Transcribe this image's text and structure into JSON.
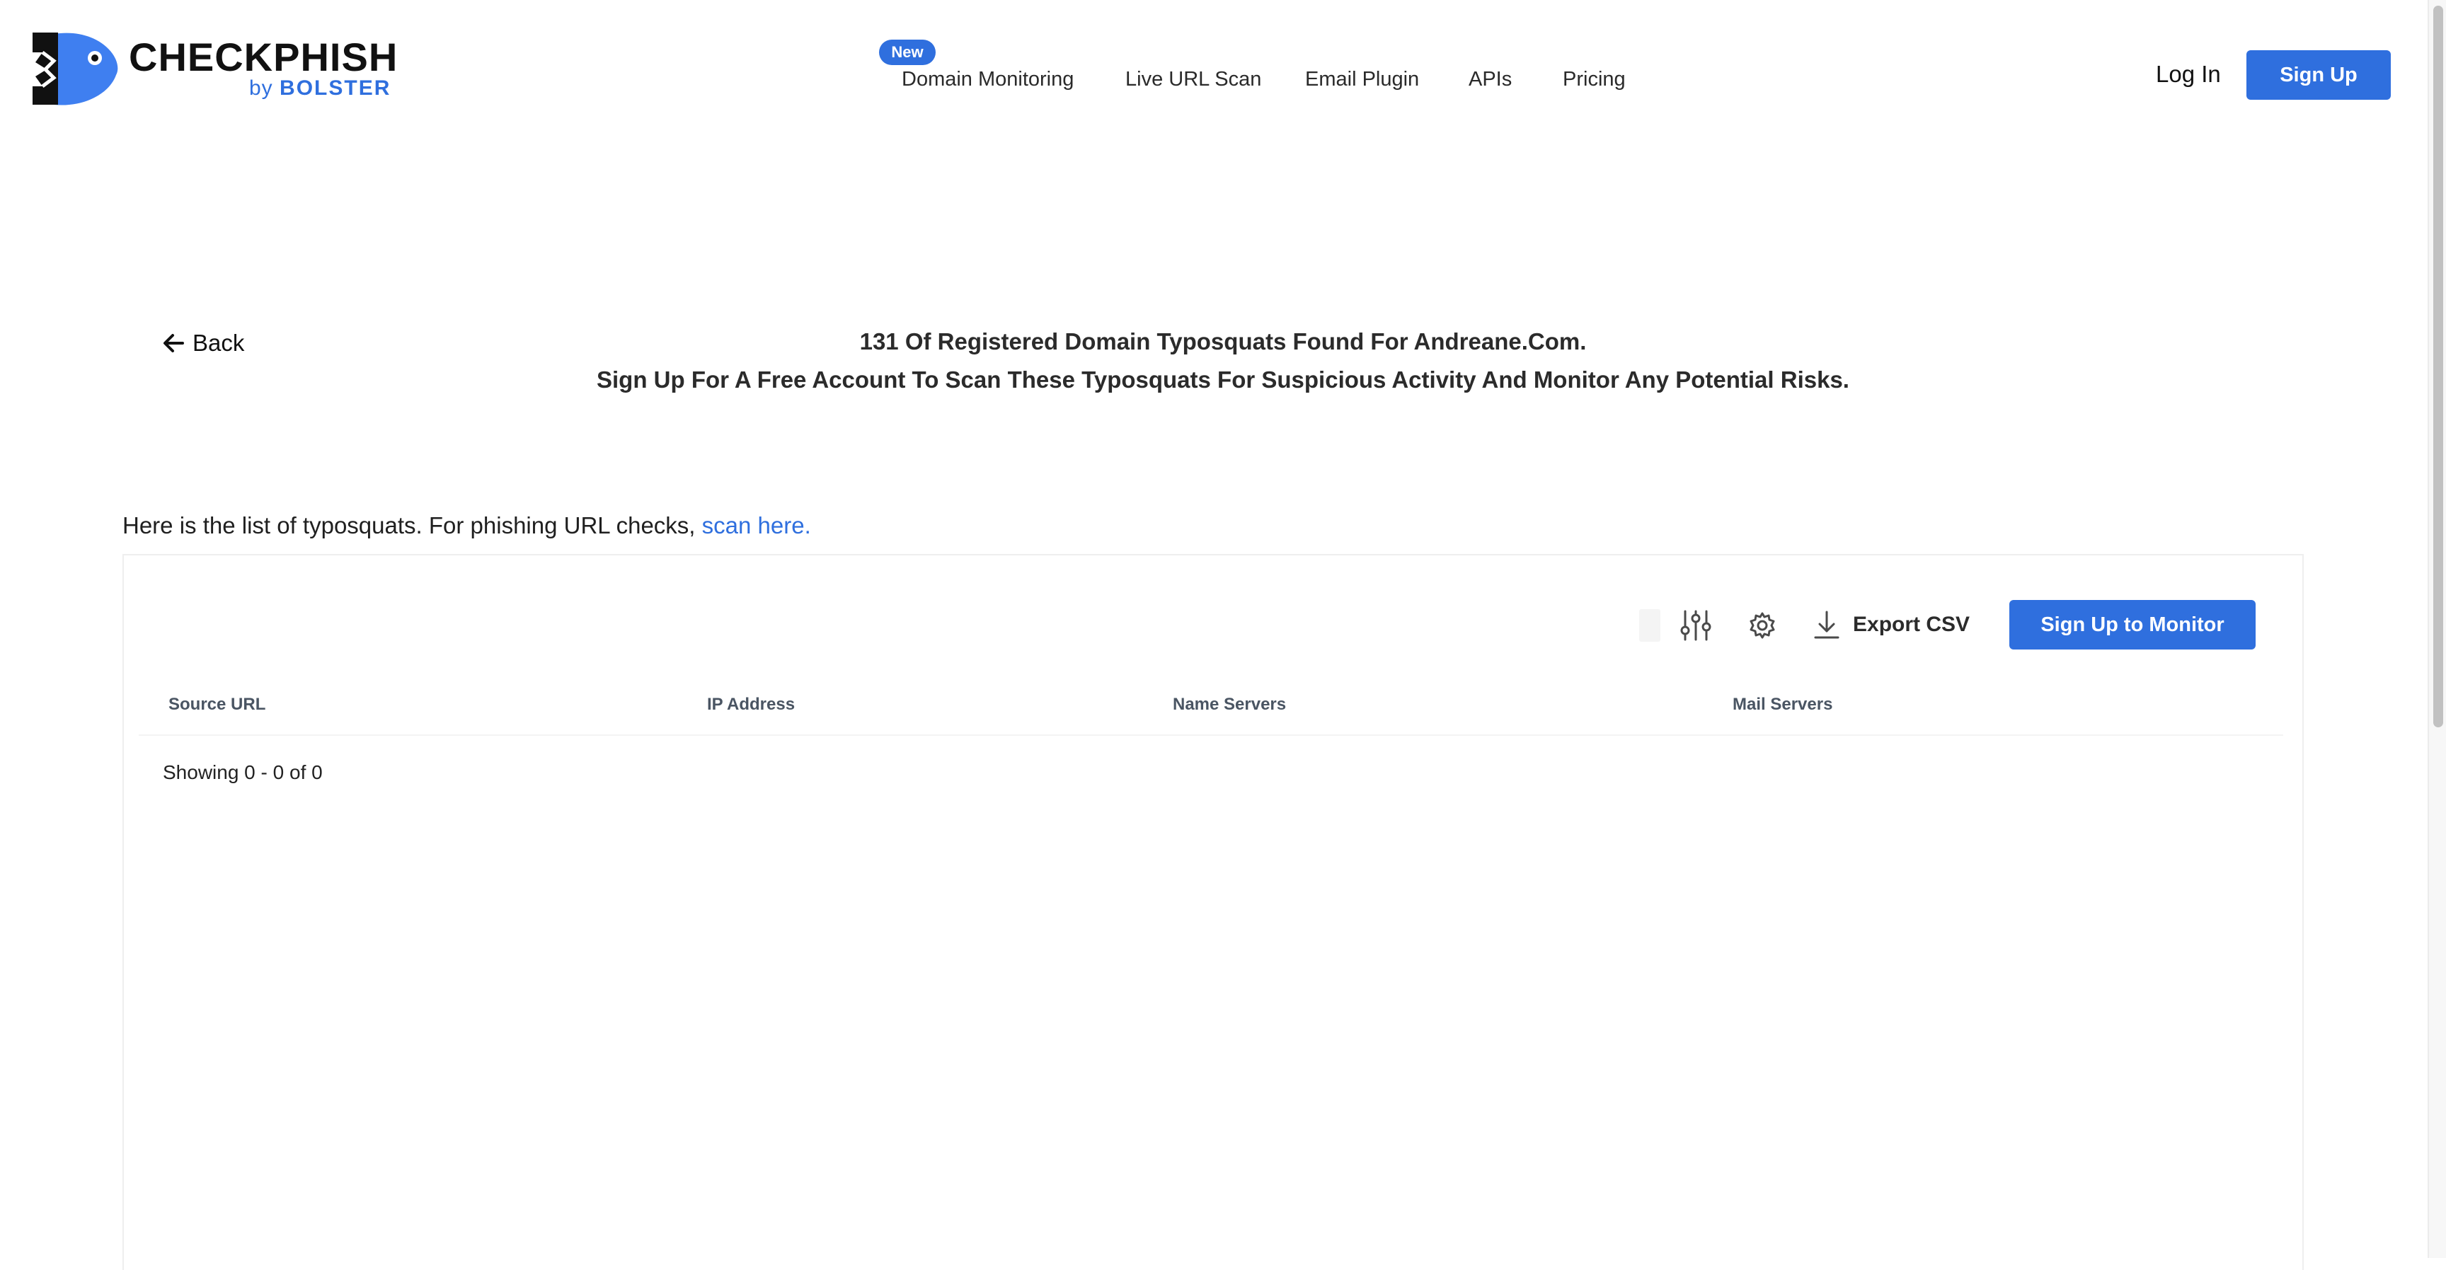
{
  "brand": {
    "name": "CHECKPHISH",
    "by_prefix": "by",
    "by_company": "BOLSTER",
    "primary_color": "#2f6fde"
  },
  "nav": {
    "badge_new": "New",
    "items": [
      "Domain Monitoring",
      "Live URL Scan",
      "Email Plugin",
      "APIs",
      "Pricing"
    ],
    "login": "Log In",
    "signup": "Sign Up"
  },
  "page": {
    "back_label": "Back",
    "headline_1": "131 Of Registered Domain Typosquats Found For Andreane.Com.",
    "headline_2": "Sign Up For A Free Account To Scan These Typosquats For Suspicious Activity And Monitor Any Potential Risks.",
    "intro_text": "Here is the list of typosquats. For phishing URL checks, ",
    "intro_link": "scan here."
  },
  "table": {
    "toolbar": {
      "filter_icon": "sliders-icon",
      "settings_icon": "gear-icon",
      "export_icon": "download-icon",
      "export_label": "Export CSV",
      "monitor_label": "Sign Up to Monitor"
    },
    "columns": [
      "Source URL",
      "IP Address",
      "Name Servers",
      "Mail Servers"
    ],
    "rows": [],
    "showing": "Showing 0 - 0 of 0"
  }
}
